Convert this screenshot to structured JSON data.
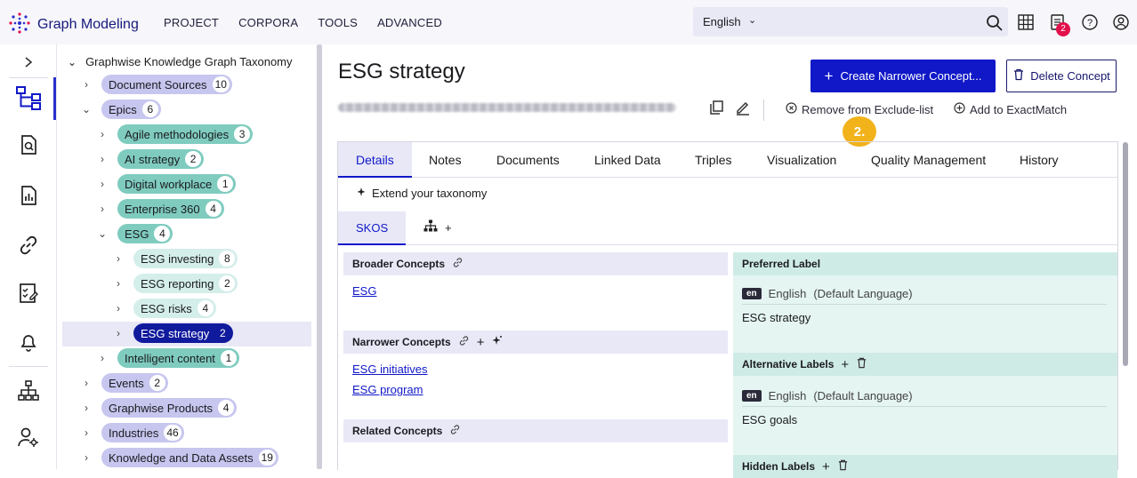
{
  "app": {
    "title": "Graph Modeling",
    "accent": "#1018c8"
  },
  "topnav": {
    "items": [
      "PROJECT",
      "CORPORA",
      "TOOLS",
      "ADVANCED"
    ]
  },
  "language": {
    "value": "English"
  },
  "notifications": {
    "count": "2"
  },
  "rail": {
    "icons": [
      "chevron-right-icon",
      "taxonomy-tree-icon",
      "search-document-icon",
      "report-icon",
      "link-icon",
      "checklist-icon",
      "bell-icon",
      "hierarchy-icon",
      "user-settings-icon"
    ]
  },
  "tree": {
    "root": "Graphwise Knowledge Graph Taxonomy",
    "nodes": [
      {
        "label": "Document Sources",
        "count": "10"
      },
      {
        "label": "Epics",
        "count": "6"
      },
      {
        "label": "Agile methodologies",
        "count": "3"
      },
      {
        "label": "AI strategy",
        "count": "2"
      },
      {
        "label": "Digital workplace",
        "count": "1"
      },
      {
        "label": "Enterprise 360",
        "count": "4"
      },
      {
        "label": "ESG",
        "count": "4"
      },
      {
        "label": "ESG investing",
        "count": "8"
      },
      {
        "label": "ESG reporting",
        "count": "2"
      },
      {
        "label": "ESG risks",
        "count": "4"
      },
      {
        "label": "ESG strategy",
        "count": "2"
      },
      {
        "label": "Intelligent content",
        "count": "1"
      },
      {
        "label": "Events",
        "count": "2"
      },
      {
        "label": "Graphwise Products",
        "count": "4"
      },
      {
        "label": "Industries",
        "count": "46"
      },
      {
        "label": "Knowledge and Data Assets",
        "count": "19"
      }
    ]
  },
  "concept": {
    "title": "ESG strategy",
    "create_button": "Create Narrower Concept...",
    "delete_button": "Delete Concept",
    "remove_exclude": "Remove from Exclude-list",
    "add_exact": "Add to ExactMatch",
    "step_marker": "2."
  },
  "tabs": [
    "Details",
    "Notes",
    "Documents",
    "Linked Data",
    "Triples",
    "Visualization",
    "Quality Management",
    "History"
  ],
  "extend": "Extend your taxonomy",
  "subtabs": {
    "skos": "SKOS",
    "plus": "+"
  },
  "left_sections": {
    "broader": {
      "title": "Broader Concepts",
      "links": [
        "ESG"
      ]
    },
    "narrower": {
      "title": "Narrower Concepts",
      "links": [
        "ESG initiatives",
        "ESG program"
      ]
    },
    "related": {
      "title": "Related Concepts"
    }
  },
  "right_sections": {
    "preferred": {
      "title": "Preferred Label",
      "lang_code": "en",
      "lang": "English",
      "lang_note": "(Default Language)",
      "value": "ESG strategy"
    },
    "alternative": {
      "title": "Alternative Labels",
      "lang_code": "en",
      "lang": "English",
      "lang_note": "(Default Language)",
      "value": "ESG goals"
    },
    "hidden": {
      "title": "Hidden Labels"
    }
  }
}
